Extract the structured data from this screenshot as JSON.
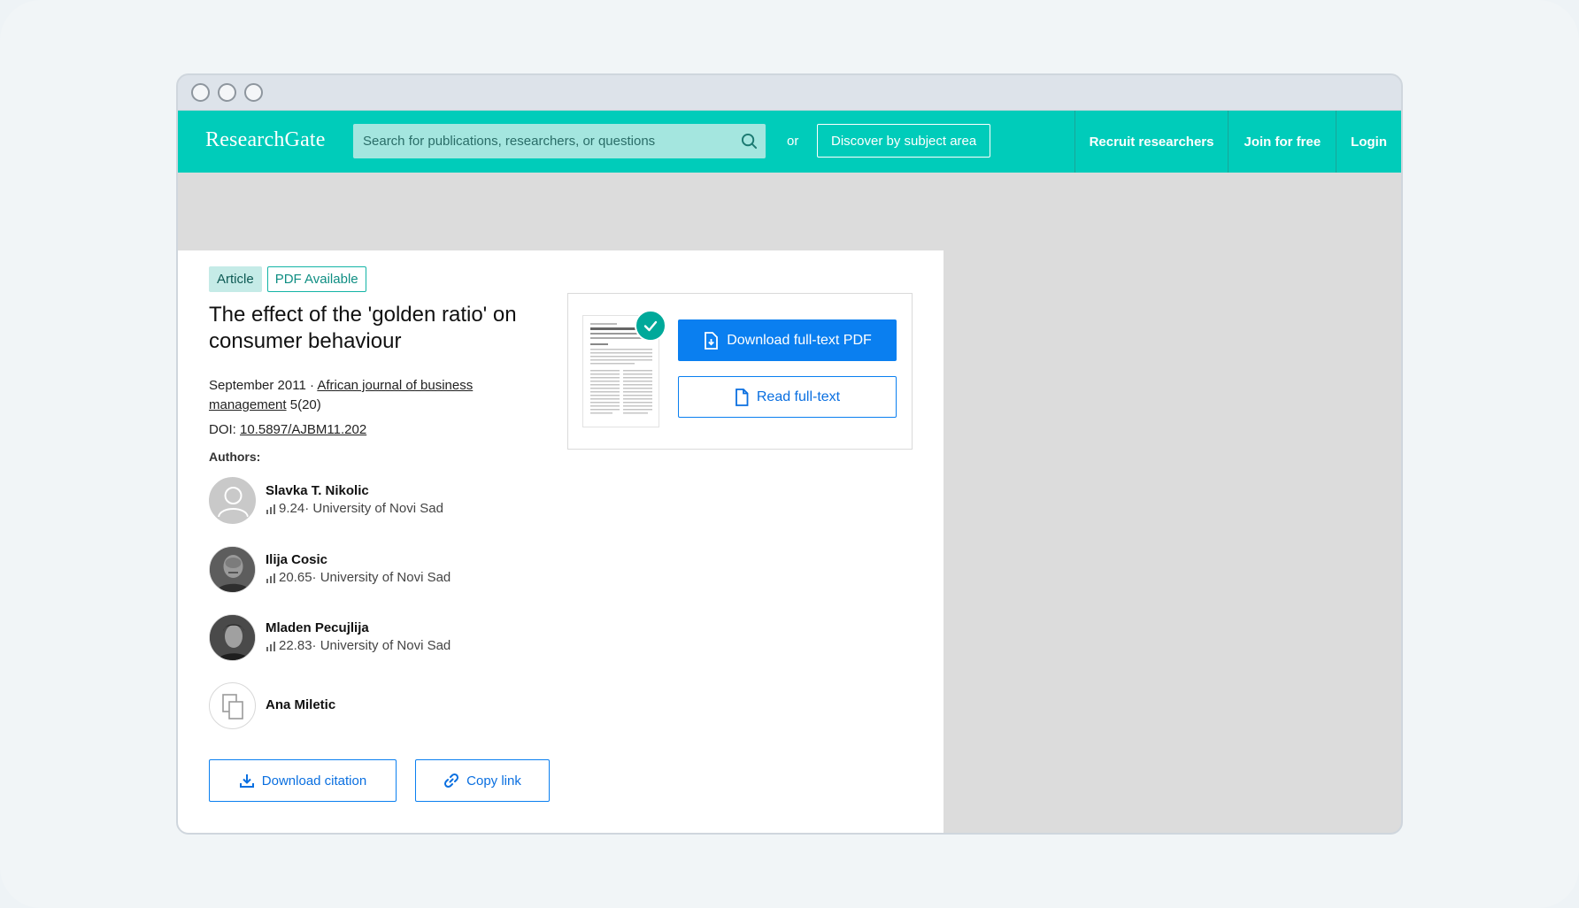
{
  "browser": {
    "controls": [
      "close",
      "minimize",
      "zoom"
    ]
  },
  "navbar": {
    "logo": "ResearchGate",
    "search_placeholder": "Search for publications, researchers, or questions",
    "or_text": "or",
    "discover_label": "Discover by subject area",
    "links": [
      "Recruit researchers",
      "Join for free",
      "Login"
    ],
    "accent_color": "#00ccba"
  },
  "article": {
    "tag_type": "Article",
    "tag_pdf": "PDF Available",
    "title": "The effect of the 'golden ratio' on consumer behaviour",
    "date": "September 2011 · ",
    "journal": "African journal of business management",
    "volume": " 5(20)",
    "doi_label": "DOI: ",
    "doi": "10.5897/AJBM11.202",
    "authors_label": "Authors:",
    "authors": [
      {
        "name": "Slavka T. Nikolic",
        "score": "9.24",
        "affiliation": " · University of Novi Sad",
        "avatar": "placeholder-person-icon"
      },
      {
        "name": "Ilija Cosic",
        "score": "20.65",
        "affiliation": " · University of Novi Sad",
        "avatar": "photo"
      },
      {
        "name": "Mladen Pecujlija",
        "score": "22.83",
        "affiliation": " · University of Novi Sad",
        "avatar": "photo"
      },
      {
        "name": "Ana Miletic",
        "score": "",
        "affiliation": "",
        "avatar": "placeholder-copy-icon"
      }
    ],
    "download_citation": "Download citation",
    "copy_link": "Copy link"
  },
  "pdf_panel": {
    "download_pdf": "Download full-text PDF",
    "read_full_text": "Read full-text",
    "primary_color": "#0a7ff0"
  }
}
